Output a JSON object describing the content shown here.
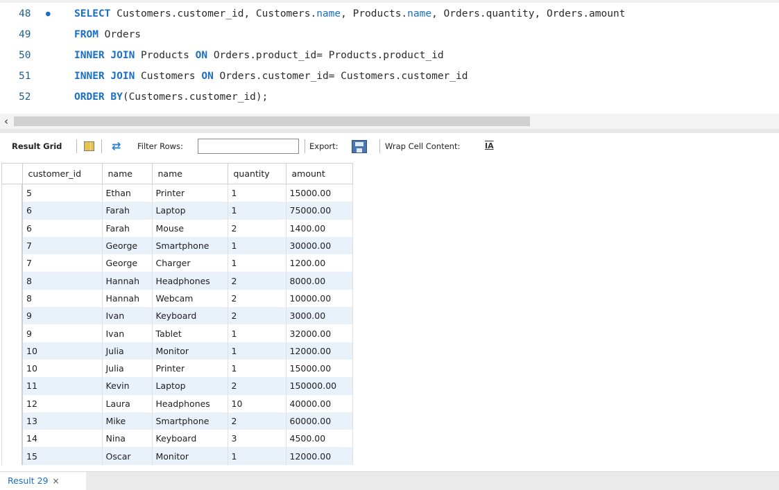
{
  "editor": {
    "lines": [
      {
        "number": "48",
        "has_marker": true,
        "tokens": [
          {
            "t": "SELECT",
            "c": "kw"
          },
          {
            "t": " Customers.customer_id, Customers.",
            "c": ""
          },
          {
            "t": "name",
            "c": "ident-blue"
          },
          {
            "t": ", Products.",
            "c": ""
          },
          {
            "t": "name",
            "c": "ident-blue"
          },
          {
            "t": ", Orders.quantity, Orders.amount",
            "c": ""
          }
        ]
      },
      {
        "number": "49",
        "has_marker": false,
        "tokens": [
          {
            "t": "FROM",
            "c": "kw"
          },
          {
            "t": " Orders",
            "c": ""
          }
        ]
      },
      {
        "number": "50",
        "has_marker": false,
        "tokens": [
          {
            "t": "INNER JOIN",
            "c": "kw"
          },
          {
            "t": " Products ",
            "c": ""
          },
          {
            "t": "ON",
            "c": "kw"
          },
          {
            "t": " Orders.product_id= Products.product_id",
            "c": ""
          }
        ]
      },
      {
        "number": "51",
        "has_marker": false,
        "tokens": [
          {
            "t": "INNER JOIN",
            "c": "kw"
          },
          {
            "t": " Customers ",
            "c": ""
          },
          {
            "t": "ON",
            "c": "kw"
          },
          {
            "t": " Orders.customer_id= Customers.customer_id",
            "c": ""
          }
        ]
      },
      {
        "number": "52",
        "has_marker": false,
        "tokens": [
          {
            "t": "ORDER BY",
            "c": "kw"
          },
          {
            "t": "(Customers.customer_id);",
            "c": ""
          }
        ]
      }
    ]
  },
  "scrollbar": {
    "left_arrow": "‹"
  },
  "toolbar": {
    "result_grid_label": "Result Grid",
    "filter_label": "Filter Rows:",
    "filter_value": "",
    "export_label": "Export:",
    "wrap_label": "Wrap Cell Content:",
    "wrap_icon_glyph": "IA"
  },
  "grid": {
    "columns": [
      "customer_id",
      "name",
      "name",
      "quantity",
      "amount"
    ],
    "rows": [
      [
        "5",
        "Ethan",
        "Printer",
        "1",
        "15000.00"
      ],
      [
        "6",
        "Farah",
        "Laptop",
        "1",
        "75000.00"
      ],
      [
        "6",
        "Farah",
        "Mouse",
        "2",
        "1400.00"
      ],
      [
        "7",
        "George",
        "Smartphone",
        "1",
        "30000.00"
      ],
      [
        "7",
        "George",
        "Charger",
        "1",
        "1200.00"
      ],
      [
        "8",
        "Hannah",
        "Headphones",
        "2",
        "8000.00"
      ],
      [
        "8",
        "Hannah",
        "Webcam",
        "2",
        "10000.00"
      ],
      [
        "9",
        "Ivan",
        "Keyboard",
        "2",
        "3000.00"
      ],
      [
        "9",
        "Ivan",
        "Tablet",
        "1",
        "32000.00"
      ],
      [
        "10",
        "Julia",
        "Monitor",
        "1",
        "12000.00"
      ],
      [
        "10",
        "Julia",
        "Printer",
        "1",
        "15000.00"
      ],
      [
        "11",
        "Kevin",
        "Laptop",
        "2",
        "150000.00"
      ],
      [
        "12",
        "Laura",
        "Headphones",
        "10",
        "40000.00"
      ],
      [
        "13",
        "Mike",
        "Smartphone",
        "2",
        "60000.00"
      ],
      [
        "14",
        "Nina",
        "Keyboard",
        "3",
        "4500.00"
      ],
      [
        "15",
        "Oscar",
        "Monitor",
        "1",
        "12000.00"
      ]
    ]
  },
  "tabs": [
    {
      "label": "Result 29",
      "close": "×"
    }
  ],
  "colors": {
    "keyword": "#1a6fc2",
    "alt_row": "#e9f1fb",
    "tab_label": "#1a6fc2"
  }
}
